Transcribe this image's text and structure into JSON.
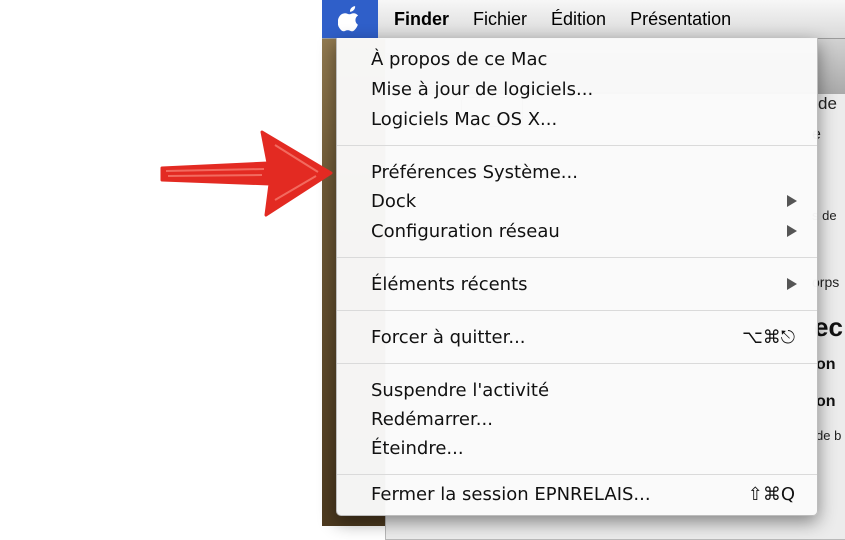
{
  "menubar": {
    "items": [
      "Finder",
      "Fichier",
      "Édition",
      "Présentation"
    ]
  },
  "apple_menu": {
    "items": [
      {
        "label": "À propos de ce Mac"
      },
      {
        "label": "Mise à jour de logiciels..."
      },
      {
        "label": "Logiciels Mac OS X..."
      },
      {
        "label": "Préférences Système..."
      },
      {
        "label": "Dock",
        "submenu": true
      },
      {
        "label": "Configuration réseau",
        "submenu": true
      },
      {
        "label": "Éléments récents",
        "submenu": true
      },
      {
        "label": "Forcer à quitter...",
        "shortcut": "⌥⌘⎋"
      },
      {
        "label": "Suspendre l'activité"
      },
      {
        "label": "Redémarrer..."
      },
      {
        "label": "Éteindre..."
      },
      {
        "label": "Fermer la session EPNRELAIS...",
        "shortcut": "⇧⌘Q"
      }
    ]
  },
  "background_window": {
    "fragments": [
      "de",
      "e",
      "s de",
      "orps",
      "ec",
      "on",
      "on",
      "de b"
    ]
  },
  "colors": {
    "menubar_highlight": "#2f5fc9",
    "annotation_arrow": "#e32a22"
  },
  "icons": {
    "apple": "apple-logo-icon",
    "arrow": "red-hand-drawn-arrow"
  }
}
